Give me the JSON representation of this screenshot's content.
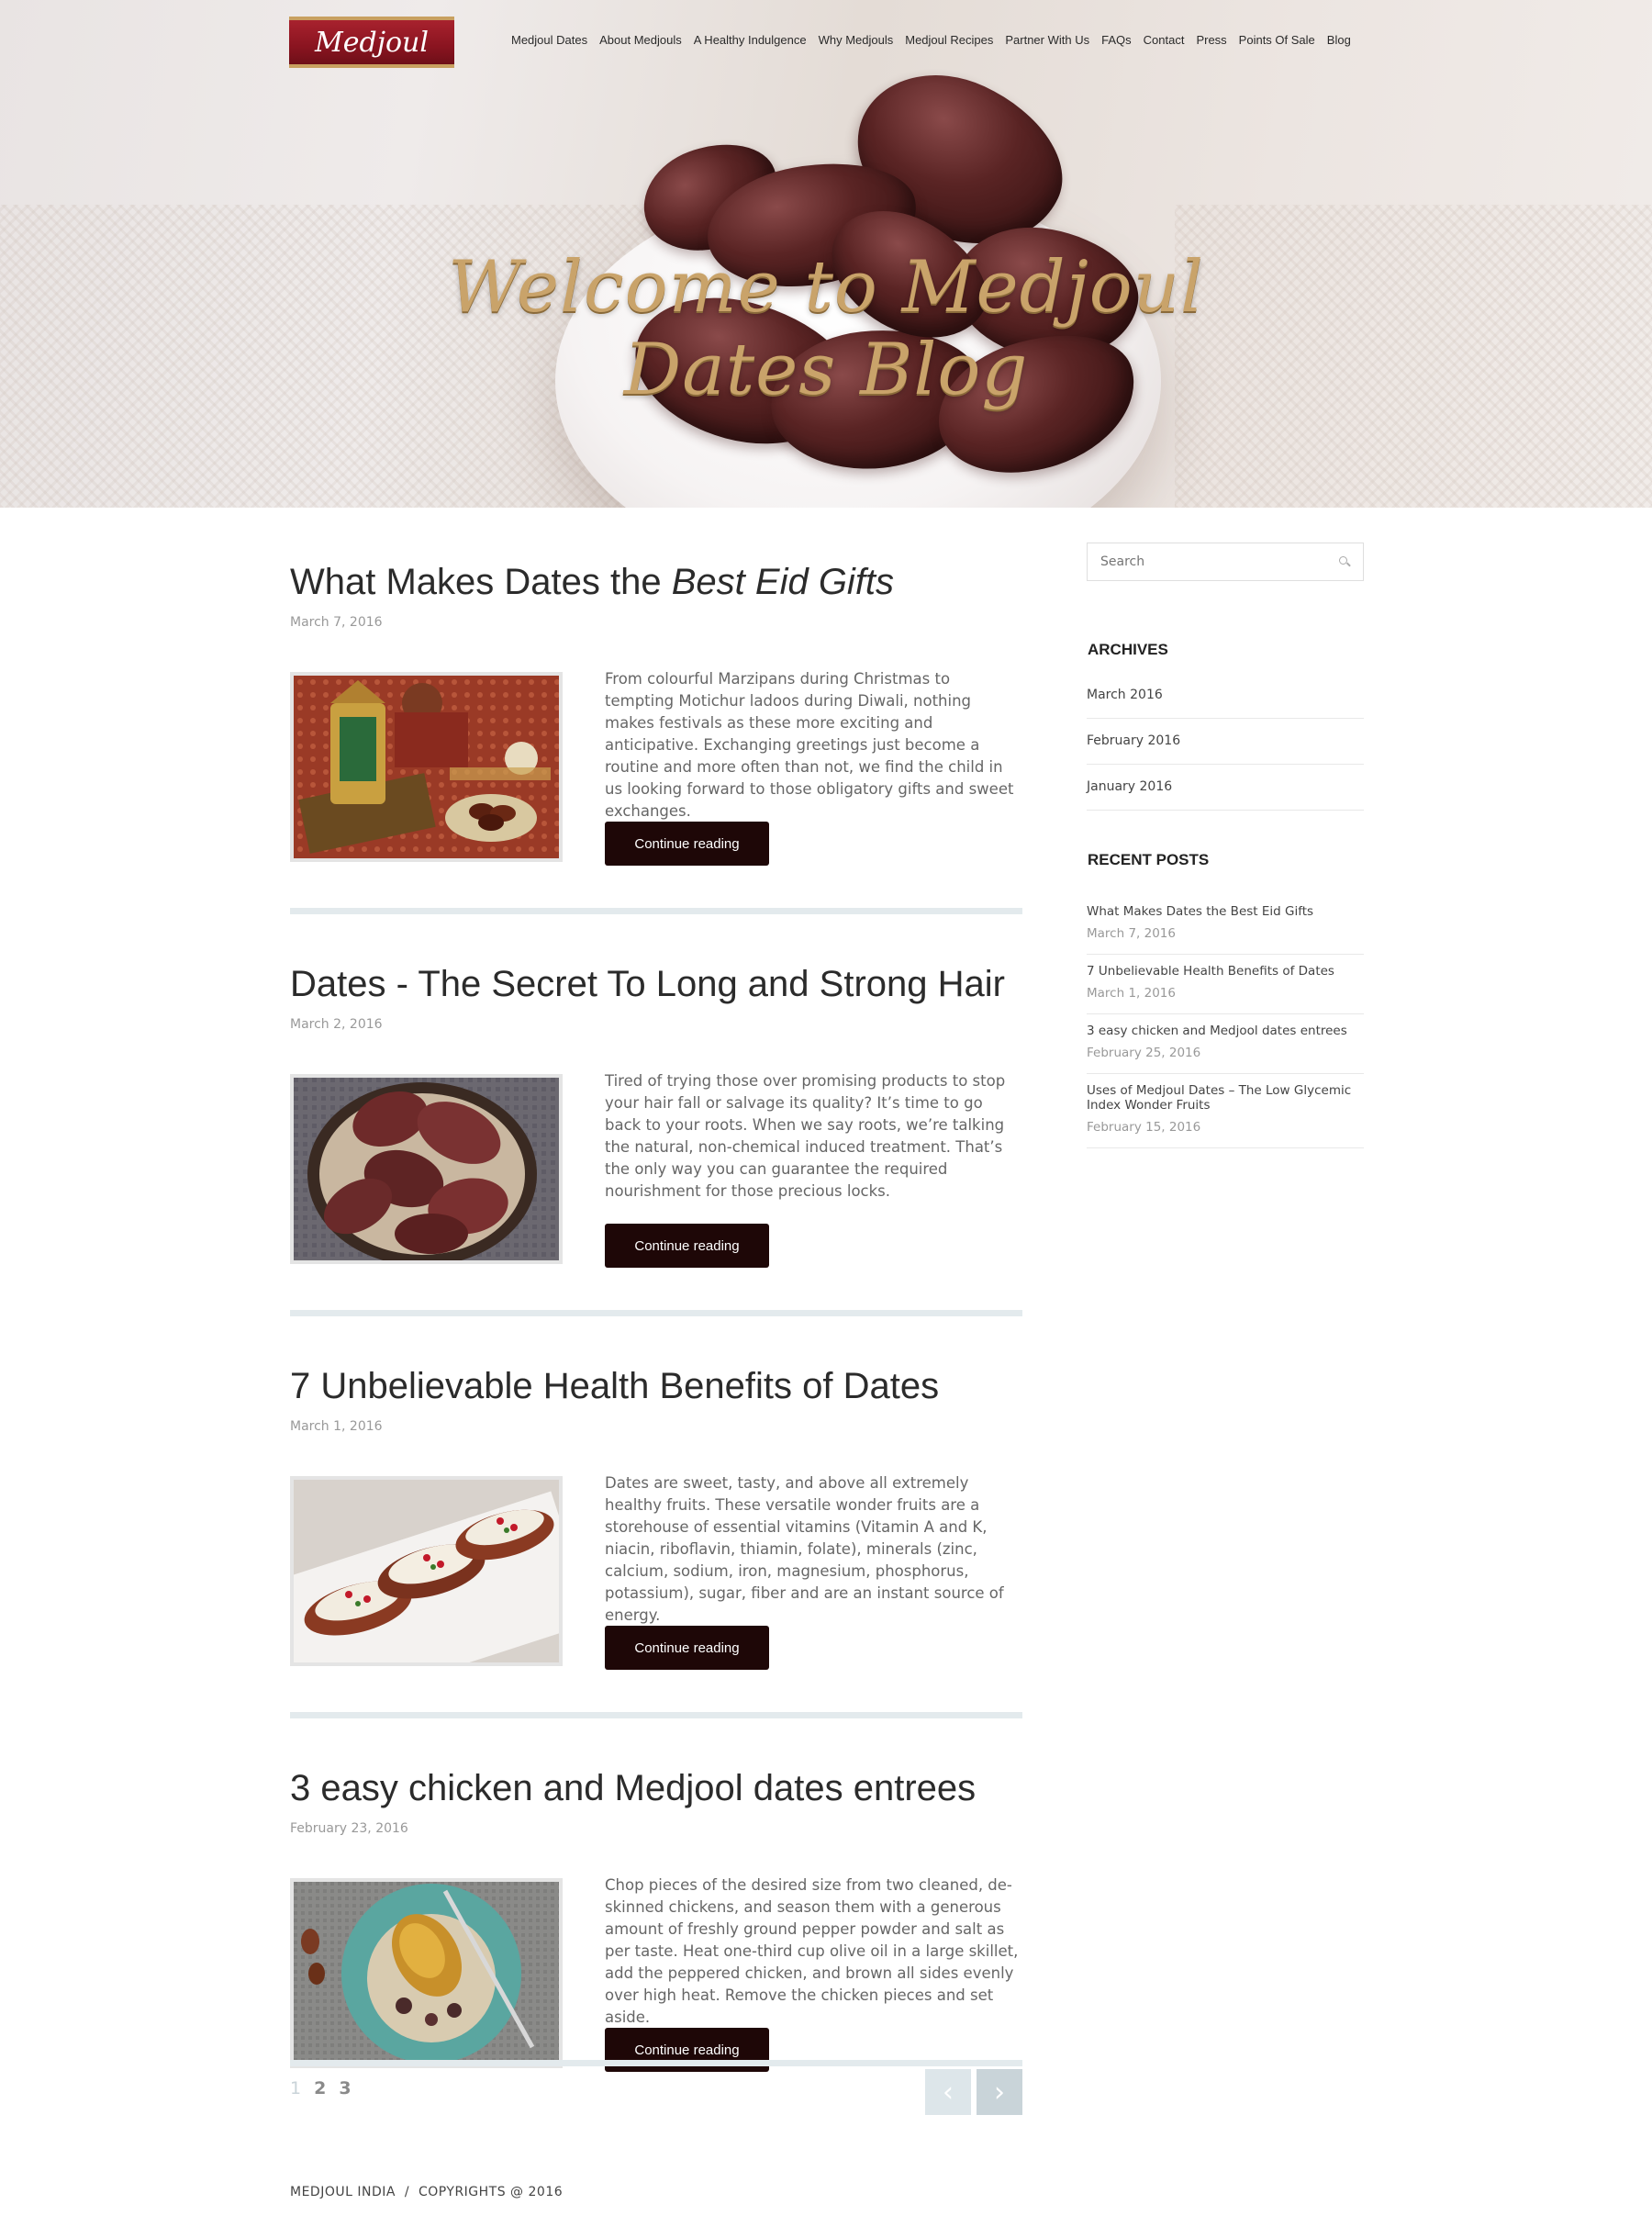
{
  "header": {
    "logo_text": "Medjoul",
    "nav": [
      "Medjoul Dates",
      "About Medjouls",
      "A Healthy Indulgence",
      "Why Medjouls",
      "Medjoul Recipes",
      "Partner With Us",
      "FAQs",
      "Contact",
      "Press",
      "Points Of Sale",
      "Blog"
    ]
  },
  "hero": {
    "title": "Welcome to Medjoul Dates Blog"
  },
  "posts": [
    {
      "title_plain": "What Makes Dates the ",
      "title_em": "Best Eid Gifts",
      "date": "March 7, 2016",
      "excerpt": "From colourful Marzipans during Christmas to tempting Motichur ladoos during Diwali, nothing makes festivals as these more exciting and anticipative. Exchanging greetings just become a routine and more often than not, we find the child in us looking forward to those obligatory gifts and sweet exchanges.",
      "button": "Continue reading"
    },
    {
      "title_plain": "Dates - The Secret To Long and Strong Hair",
      "title_em": "",
      "date": "March 2, 2016",
      "excerpt": "Tired of trying those over promising products to stop your hair fall or salvage its quality? It’s time to go back to your roots. When we say roots, we’re talking the natural, non-chemical induced treatment. That’s the only way you can guarantee the required nourishment for those precious locks.",
      "button": "Continue reading"
    },
    {
      "title_plain": "7 Unbelievable Health Benefits of Dates",
      "title_em": "",
      "date": "March 1, 2016",
      "excerpt": "Dates are sweet, tasty, and above all extremely healthy fruits. These versatile wonder fruits are a storehouse of essential vitamins (Vitamin A and K, niacin, riboflavin, thiamin, folate), minerals (zinc, calcium, sodium, iron, magnesium, phosphorus, potassium), sugar, fiber and are an instant source of energy.",
      "button": "Continue reading"
    },
    {
      "title_plain": "3 easy chicken and Medjool dates entrees",
      "title_em": "",
      "date": "February 23, 2016",
      "excerpt": "Chop pieces of the desired size from two cleaned, de-skinned chickens, and season them with a generous amount of freshly ground pepper powder and salt as per taste. Heat one-third cup olive oil in a large skillet, add the peppered chicken, and brown all sides evenly over high heat. Remove the chicken pieces and set aside.",
      "button": "Continue reading"
    }
  ],
  "pagination": {
    "pages": [
      "1",
      "2",
      "3"
    ],
    "current": "1"
  },
  "footer": {
    "text": "MEDJOUL INDIA  /  COPYRIGHTS @ 2016"
  },
  "sidebar": {
    "search_placeholder": "Search",
    "archives_title": "ARCHIVES",
    "archives": [
      "March 2016",
      "February 2016",
      "January 2016"
    ],
    "recent_title": "RECENT POSTS",
    "recent": [
      {
        "title": "What Makes Dates the Best Eid Gifts",
        "date": "March 7, 2016"
      },
      {
        "title": "7 Unbelievable Health Benefits of Dates",
        "date": "March 1, 2016"
      },
      {
        "title": "3 easy chicken and Medjool dates entrees",
        "date": "February 25, 2016"
      },
      {
        "title": "Uses of Medjoul Dates – The Low Glycemic Index Wonder Fruits",
        "date": "February 15, 2016"
      }
    ]
  },
  "colors": {
    "brand": "#8a1420",
    "button": "#1e0707",
    "divider": "#e3eaed",
    "hero_title": "#c9a36a"
  },
  "icons": {
    "search": "search-icon",
    "prev": "chevron-left-icon",
    "next": "chevron-right-icon"
  }
}
